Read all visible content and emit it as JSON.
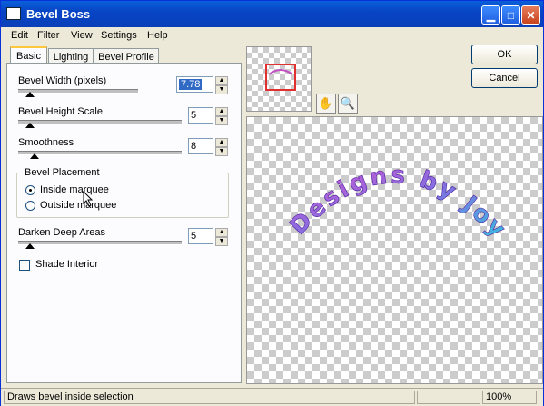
{
  "window": {
    "title": "Bevel Boss"
  },
  "titlebar": {
    "minimize": "▁",
    "maximize": "□",
    "close": "✕"
  },
  "menu": [
    "Edit",
    "Filter",
    "View",
    "Settings",
    "Help"
  ],
  "tabs": [
    "Basic",
    "Lighting",
    "Bevel Profile"
  ],
  "basic": {
    "bevel_width": {
      "label": "Bevel Width (pixels)",
      "value": "7.78",
      "level": 0.05
    },
    "bevel_height": {
      "label": "Bevel Height Scale",
      "value": "5",
      "level": 0.05
    },
    "smoothness": {
      "label": "Smoothness",
      "value": "8",
      "level": 0.08
    },
    "placement": {
      "title": "Bevel Placement",
      "inside": "Inside marquee",
      "outside": "Outside marquee",
      "selected": "inside"
    },
    "darken": {
      "label": "Darken Deep Areas",
      "value": "5",
      "level": 0.05
    },
    "shade_interior": {
      "label": "Shade Interior",
      "checked": false
    }
  },
  "buttons": {
    "ok": "OK",
    "cancel": "Cancel"
  },
  "tools": {
    "pan": "✋",
    "zoom": "🔍"
  },
  "preview": {
    "text": "Designs by Joy"
  },
  "status": {
    "text": "Draws bevel inside selection",
    "zoom": "100%"
  },
  "colors": {
    "accent": "#0a5fd8",
    "preview_text_a": "#d040d0",
    "preview_text_b": "#40c0e0"
  }
}
